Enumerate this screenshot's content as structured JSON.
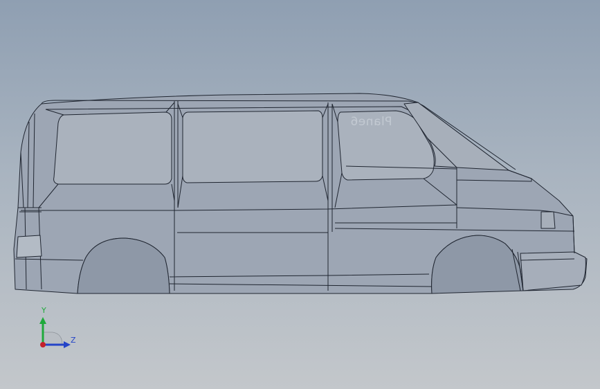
{
  "viewport": {
    "background_top": "#8f9fb2",
    "background_bottom": "#c3c7cb"
  },
  "model": {
    "body_color": "#9da6b4",
    "window_color": "#aab2bd",
    "edge_color": "#1f2530",
    "reference_plane_label": "Plane6"
  },
  "triad": {
    "y_label": "Y",
    "z_label": "Z",
    "y_color": "#1fa93b",
    "z_color": "#2444c8",
    "x_color": "#c4202a"
  }
}
